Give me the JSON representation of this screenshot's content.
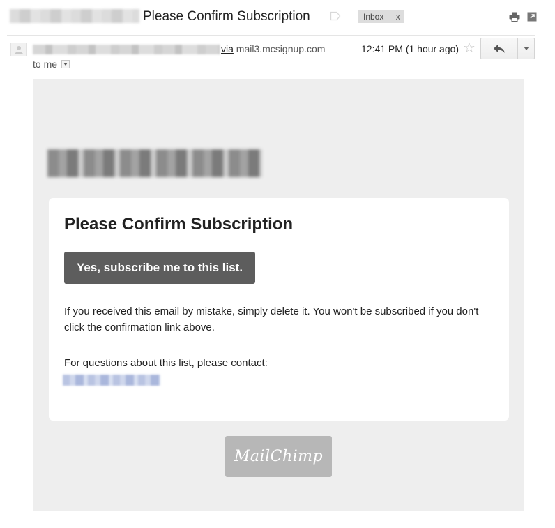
{
  "header": {
    "subject": "Please Confirm Subscription",
    "label_chip": "Inbox",
    "label_remove": "x",
    "icons": [
      "label-icon",
      "print-icon",
      "new-window-icon"
    ]
  },
  "sender": {
    "via_word": "via",
    "via_domain": "mail3.mcsignup.com",
    "time": "12:41 PM (1 hour ago)",
    "to": "to me",
    "icons": [
      "avatar-icon",
      "star-icon",
      "reply-icon",
      "more-options-icon",
      "dropdown-icon"
    ]
  },
  "email": {
    "title": "Please Confirm Subscription",
    "button_label": "Yes, subscribe me to this list.",
    "body_text": "If you received this email by mistake, simply delete it. You won't be subscribed if you don't click the confirmation link above.",
    "contact_text": "For questions about this list, please contact:",
    "footer_logo": "MailChimp"
  },
  "colors": {
    "canvas_bg": "#eeeeee",
    "card_bg": "#ffffff",
    "button_bg": "#5d5d5d",
    "badge_bg": "#b7b7b7",
    "chip_bg": "#dddddd"
  }
}
